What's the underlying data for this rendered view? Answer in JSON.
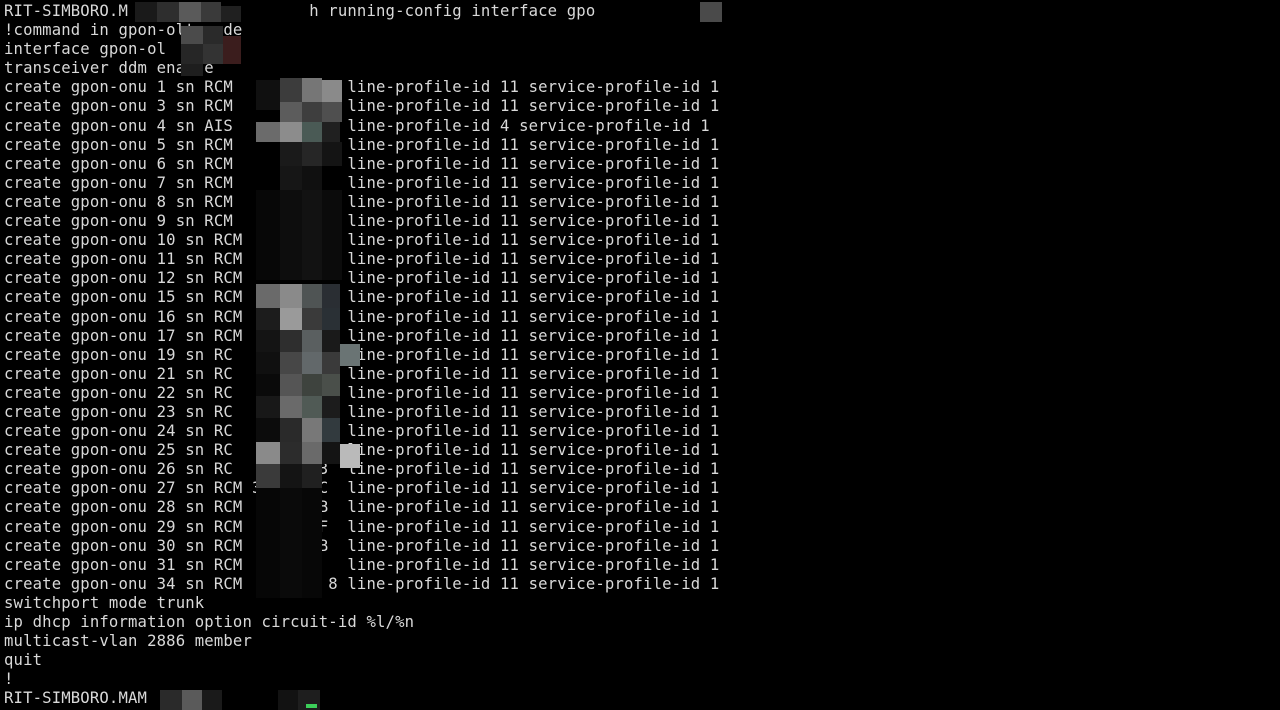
{
  "terminal": {
    "lines": [
      "RIT-SIMBORO.M                   h running-config interface gpo",
      "!command in gpon-olt mode",
      "interface gpon-ol",
      "transceiver ddm enable",
      "create gpon-onu 1 sn RCM            line-profile-id 11 service-profile-id 1",
      "create gpon-onu 3 sn RCM            line-profile-id 11 service-profile-id 1",
      "create gpon-onu 4 sn AIS            line-profile-id 4 service-profile-id 1",
      "create gpon-onu 5 sn RCM            line-profile-id 11 service-profile-id 1",
      "create gpon-onu 6 sn RCM            line-profile-id 11 service-profile-id 1",
      "create gpon-onu 7 sn RCM            line-profile-id 11 service-profile-id 1",
      "create gpon-onu 8 sn RCM            line-profile-id 11 service-profile-id 1",
      "create gpon-onu 9 sn RCM            line-profile-id 11 service-profile-id 1",
      "create gpon-onu 10 sn RCM           line-profile-id 11 service-profile-id 1",
      "create gpon-onu 11 sn RCM           line-profile-id 11 service-profile-id 1",
      "create gpon-onu 12 sn RCM           line-profile-id 11 service-profile-id 1",
      "create gpon-onu 15 sn RCM         B line-profile-id 11 service-profile-id 1",
      "create gpon-onu 16 sn RCM         E line-profile-id 11 service-profile-id 1",
      "create gpon-onu 17 sn RCM         E line-profile-id 11 service-profile-id 1",
      "create gpon-onu 19 sn RC            line-profile-id 11 service-profile-id 1",
      "create gpon-onu 21 sn RC            line-profile-id 11 service-profile-id 1",
      "create gpon-onu 22 sn RC            line-profile-id 11 service-profile-id 1",
      "create gpon-onu 23 sn RC            line-profile-id 11 service-profile-id 1",
      "create gpon-onu 24 sn RC            line-profile-id 11 service-profile-id 1",
      "create gpon-onu 25 sn RC            line-profile-id 11 service-profile-id 1",
      "create gpon-onu 26 sn RC         3  line-profile-id 11 service-profile-id 1",
      "create gpon-onu 27 sn RCM 3      C  line-profile-id 11 service-profile-id 1",
      "create gpon-onu 28 sn RCM        B  line-profile-id 11 service-profile-id 1",
      "create gpon-onu 29 sn RCM        F  line-profile-id 11 service-profile-id 1",
      "create gpon-onu 30 sn RCM        B  line-profile-id 11 service-profile-id 1",
      "create gpon-onu 31 sn RCM           line-profile-id 11 service-profile-id 1",
      "create gpon-onu 34 sn RCM         8 line-profile-id 11 service-profile-id 1",
      "switchport mode trunk",
      "ip dhcp information option circuit-id %l/%n",
      "multicast-vlan 2886 member",
      "quit",
      "!",
      "RIT-SIMBORO.MAM"
    ]
  },
  "colors": {
    "background": "#000000",
    "text": "#d9d9d9",
    "cursor": "#3ccf5a"
  }
}
